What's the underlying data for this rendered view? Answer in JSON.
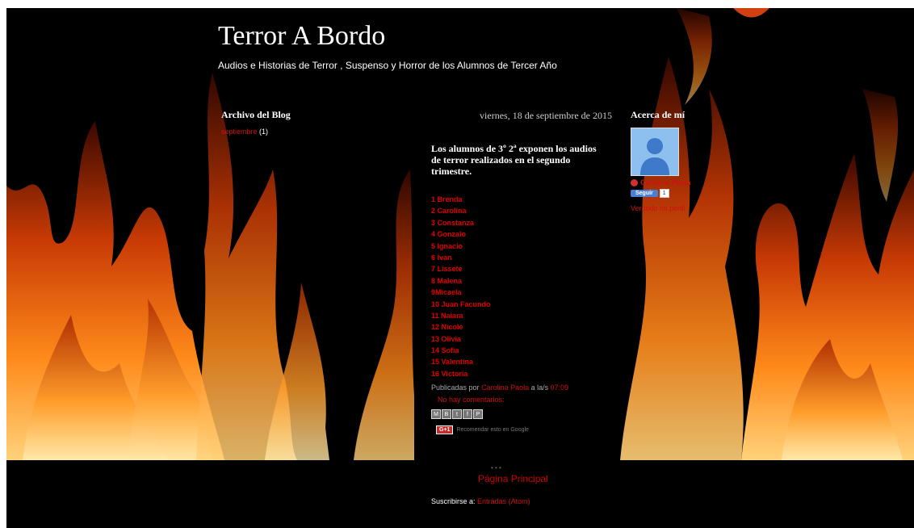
{
  "header": {
    "title": "Terror A Bordo",
    "description": "Audios e Historias de Terror , Suspenso y Horror de los Alumnos de Tercer Año"
  },
  "archive": {
    "title": "Archivo del Blog",
    "month": "septiembre",
    "count": "(1)"
  },
  "post": {
    "date": "viernes, 18 de septiembre de 2015",
    "title": "Los alumnos de 3º 2ª exponen los audios de terror realizados en el segundo trimestre.",
    "names": [
      "1 Brenda",
      "2 Carolina",
      "3 Constanza",
      "4 Gonzalo",
      "5 Ignacio",
      "6 Ivan",
      "7 Lissete",
      "8 Malena",
      "9Micaela",
      "10 Juan Facundo",
      "11 Naiara",
      "12 Nicole",
      "13 Olivia",
      "14 Sofía",
      "15 Valentina",
      "16 Victoria"
    ],
    "published_by": "Publicadas por",
    "author": "Carolina Paola",
    "at": "a la/s",
    "time": "07:09",
    "comments": "No hay comentarios:",
    "share_buttons": [
      "M",
      "B",
      "t",
      "f",
      "P"
    ],
    "gplus_label": "G+1",
    "gplus_text": "Recomendar esto en Google"
  },
  "about": {
    "title": "Acerca de mí",
    "profile_name": "Carolina Paola",
    "follow_label": "Seguir",
    "follow_count": "1",
    "full_profile": "Ver todo mi perfil"
  },
  "footer": {
    "dots": "• • •",
    "home_link": "Página Principal",
    "subscribe_label": "Suscribirse a:",
    "subscribe_link": "Entradas (Atom)"
  },
  "colors": {
    "background": "#000000",
    "link": "#d01010",
    "text": "#ffffff"
  }
}
